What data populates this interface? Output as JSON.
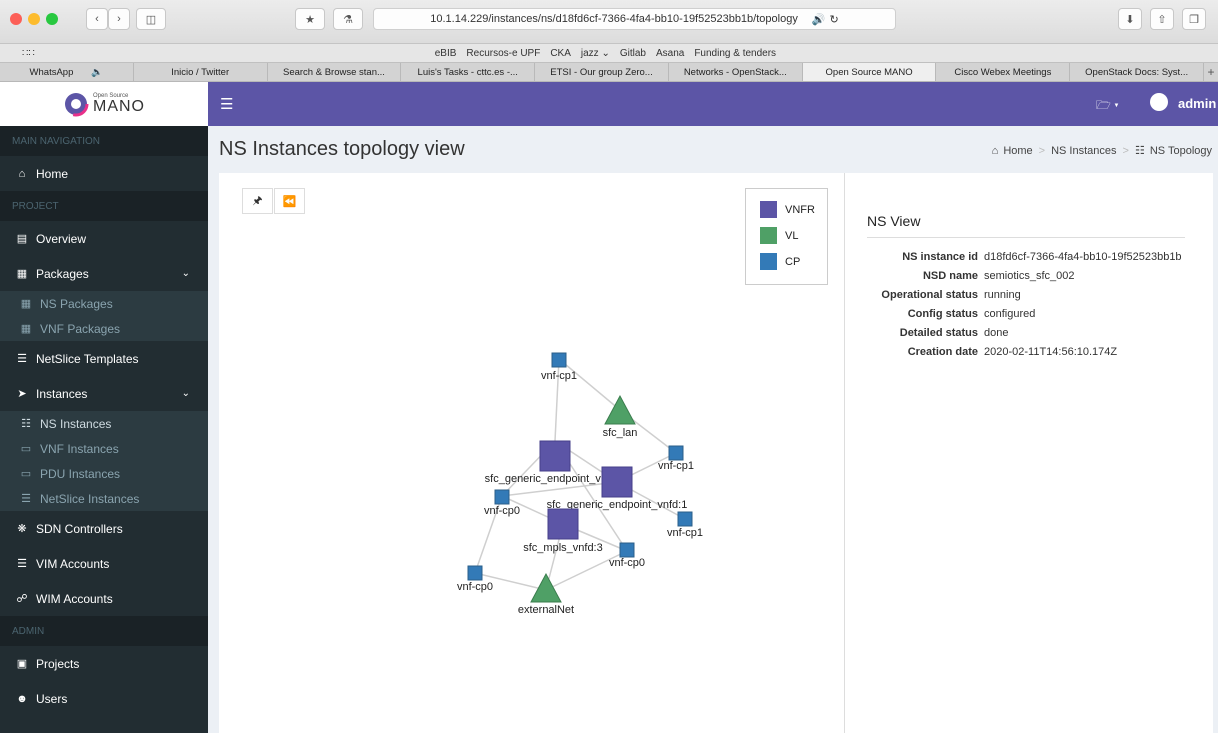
{
  "browser": {
    "url": "10.1.14.229/instances/ns/d18fd6cf-7366-4fa4-bb10-19f52523bb1b/topology",
    "bookmarks": [
      "eBIB",
      "Recursos-e UPF",
      "CKA",
      "jazz ⌄",
      "Gitlab",
      "Asana",
      "Funding & tenders"
    ],
    "tabs": [
      {
        "label": "WhatsApp",
        "active": false
      },
      {
        "label": "Inicio / Twitter",
        "active": false
      },
      {
        "label": "Search & Browse stan...",
        "active": false
      },
      {
        "label": "Luis's Tasks - cttc.es -...",
        "active": false
      },
      {
        "label": "ETSI - Our group Zero...",
        "active": false
      },
      {
        "label": "Networks - OpenStack...",
        "active": false
      },
      {
        "label": "Open Source MANO",
        "active": true
      },
      {
        "label": "Cisco Webex Meetings",
        "active": false
      },
      {
        "label": "OpenStack Docs: Syst...",
        "active": false
      }
    ]
  },
  "app": {
    "logo_small": "Open Source",
    "logo_big": "MANO",
    "user": "admin"
  },
  "sidebar": {
    "main_header": "MAIN NAVIGATION",
    "home": "Home",
    "project_header": "PROJECT",
    "overview": "Overview",
    "packages": "Packages",
    "ns_packages": "NS Packages",
    "vnf_packages": "VNF Packages",
    "netslice_templates": "NetSlice Templates",
    "instances": "Instances",
    "ns_instances": "NS Instances",
    "vnf_instances": "VNF Instances",
    "pdu_instances": "PDU Instances",
    "netslice_instances": "NetSlice Instances",
    "sdn_controllers": "SDN Controllers",
    "vim_accounts": "VIM Accounts",
    "wim_accounts": "WIM Accounts",
    "admin_header": "ADMIN",
    "projects": "Projects",
    "users": "Users"
  },
  "page": {
    "title": "NS Instances topology view",
    "breadcrumb": [
      "Home",
      "NS Instances",
      "NS Topology"
    ]
  },
  "legend": [
    {
      "label": "VNFR",
      "color": "#5c55a6"
    },
    {
      "label": "VL",
      "color": "#4fa066"
    },
    {
      "label": "CP",
      "color": "#337ab7"
    }
  ],
  "topology": {
    "nodes": [
      {
        "label": "vnf-cp1",
        "type": "CP"
      },
      {
        "label": "sfc_lan",
        "type": "VL"
      },
      {
        "label": "vnf-cp1",
        "type": "CP"
      },
      {
        "label": "sfc_generic_endpoint_vnfd:2",
        "type": "VNFR"
      },
      {
        "label": "sfc_generic_endpoint_vnfd:1",
        "type": "VNFR"
      },
      {
        "label": "vnf-cp0",
        "type": "CP"
      },
      {
        "label": "vnf-cp1",
        "type": "CP"
      },
      {
        "label": "sfc_mpls_vnfd:3",
        "type": "VNFR"
      },
      {
        "label": "vnf-cp0",
        "type": "CP"
      },
      {
        "label": "vnf-cp0",
        "type": "CP"
      },
      {
        "label": "externalNet",
        "type": "VL"
      }
    ]
  },
  "ns_view": {
    "title": "NS View",
    "rows": [
      {
        "key": "NS instance id",
        "value": "d18fd6cf-7366-4fa4-bb10-19f52523bb1b"
      },
      {
        "key": "NSD name",
        "value": "semiotics_sfc_002"
      },
      {
        "key": "Operational status",
        "value": "running"
      },
      {
        "key": "Config status",
        "value": "configured"
      },
      {
        "key": "Detailed status",
        "value": "done"
      },
      {
        "key": "Creation date",
        "value": "2020-02-11T14:56:10.174Z"
      }
    ]
  }
}
